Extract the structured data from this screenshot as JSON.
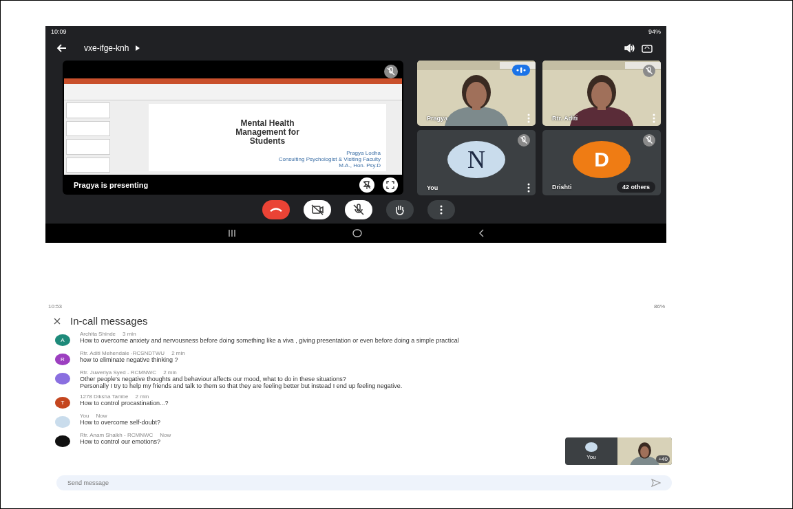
{
  "meeting": {
    "status_bar": {
      "time": "10:09",
      "battery": "94%"
    },
    "code": "vxe-ifge-knh",
    "presentation": {
      "slide_title": "Mental Health Management for Students",
      "slide_lines": [
        "Pragya Lodha",
        "Consulting Psychologist & Visiting Faculty",
        "M.A., Hon. Psy.D"
      ],
      "caption": "Pragya is presenting"
    },
    "tiles": [
      {
        "name": "Pragya",
        "kind": "video",
        "muted": false
      },
      {
        "name": "Rtr. Aditi",
        "kind": "video",
        "muted": true
      },
      {
        "name": "You",
        "kind": "avatar",
        "letter": "N",
        "color": "#c9dcec",
        "muted": true
      },
      {
        "name": "Drishti",
        "kind": "avatar",
        "letter": "D",
        "color": "#ef7c14",
        "muted": true,
        "others": "42 others"
      }
    ]
  },
  "chat": {
    "status_bar": {
      "time": "10:53",
      "battery": "86%"
    },
    "title": "In-call messages",
    "messages": [
      {
        "sender": "Archita Shinde",
        "time": "3 min",
        "kind": "letter",
        "letter": "A",
        "color": "#1e8a7a",
        "lines": [
          "How to overcome anxiety and nervousness before doing something like a viva , giving presentation or even before doing a simple practical"
        ]
      },
      {
        "sender": "Rtr. Aditi Mehendale -RCSNDTWU",
        "time": "2 min",
        "kind": "letter",
        "letter": "R",
        "color": "#9c3fc0",
        "lines": [
          "how to eliminate negative thinking ?"
        ]
      },
      {
        "sender": "Rtr. Juweriya Syed - RCMNWC",
        "time": "2 min",
        "kind": "plain",
        "color": "#8a6fe0",
        "lines": [
          "Other people's negative thoughts and behaviour affects our mood, what to do in these situations?",
          "Personally I try to help my friends and talk to them so that they are feeling better but instead I end up feeling negative."
        ]
      },
      {
        "sender": "1278 Diksha Tambe",
        "time": "2 min",
        "kind": "letter",
        "letter": "T",
        "color": "#c4461f",
        "lines": [
          "How to control procastination...?"
        ]
      },
      {
        "sender": "You",
        "time": "Now",
        "kind": "plain",
        "color": "#c9dcec",
        "lines": [
          "How to overcome self-doubt?"
        ]
      },
      {
        "sender": "Rtr. Anam Shaikh - RCMNWC",
        "time": "Now",
        "kind": "plain",
        "color": "#111111",
        "lines": [
          "How to control our emotions?"
        ]
      }
    ],
    "pip": {
      "label": "You",
      "count": "+40"
    },
    "placeholder": "Send message"
  }
}
